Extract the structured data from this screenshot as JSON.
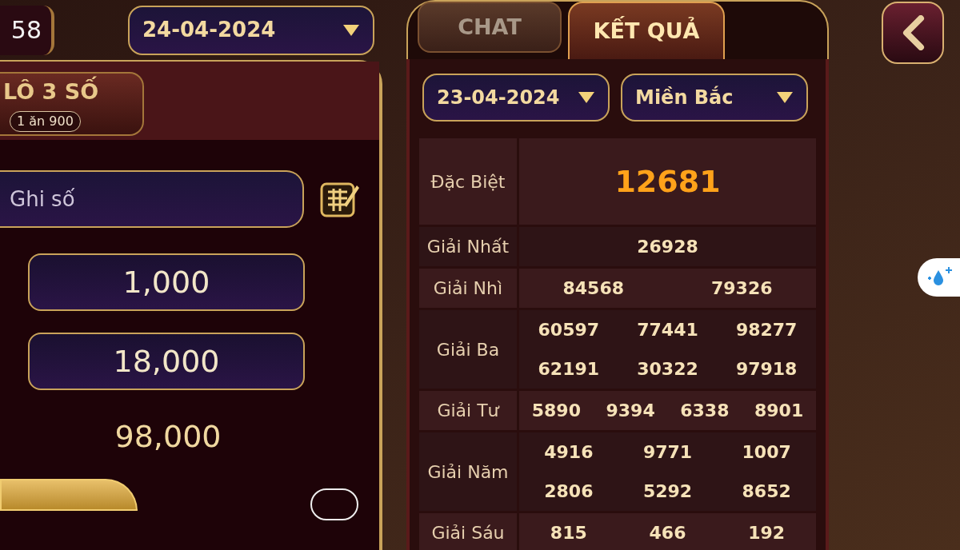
{
  "top_bar": {
    "counter": "58",
    "date_dropdown": {
      "value": "24-04-2024"
    }
  },
  "bet_panel": {
    "bet_type": {
      "label": "LÔ 3 SỐ",
      "odds": "1 ăn 900"
    },
    "number_field": {
      "placeholder": "Ghi số"
    },
    "amounts": [
      "1,000",
      "18,000"
    ],
    "total": "98,000"
  },
  "results_panel": {
    "tabs": [
      {
        "label": "CHAT",
        "selected": false
      },
      {
        "label": "KẾT QUẢ",
        "selected": true
      }
    ],
    "date_dropdown": {
      "value": "23-04-2024"
    },
    "region_dropdown": {
      "value": "Miền Bắc"
    },
    "prizes": [
      {
        "kind": "special",
        "name": "Đặc Biệt",
        "numbers": [
          "12681"
        ]
      },
      {
        "kind": "normal",
        "name": "Giải Nhất",
        "numbers": [
          "26928"
        ]
      },
      {
        "kind": "normal",
        "name": "Giải Nhì",
        "numbers": [
          "84568",
          "79326"
        ]
      },
      {
        "kind": "normal",
        "name": "Giải Ba",
        "numbers": [
          "60597",
          "77441",
          "98277",
          "62191",
          "30322",
          "97918"
        ]
      },
      {
        "kind": "normal",
        "name": "Giải Tư",
        "numbers": [
          "5890",
          "9394",
          "6338",
          "8901"
        ]
      },
      {
        "kind": "normal",
        "name": "Giải Năm",
        "numbers": [
          "4916",
          "9771",
          "1007",
          "2806",
          "5292",
          "8652"
        ]
      },
      {
        "kind": "normal",
        "name": "Giải Sáu",
        "numbers": [
          "815",
          "466",
          "192"
        ]
      }
    ]
  }
}
